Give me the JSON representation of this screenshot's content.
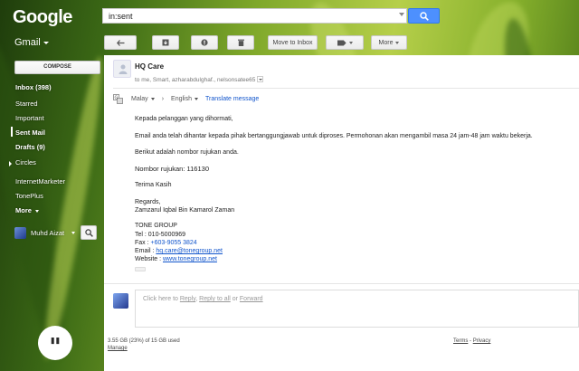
{
  "header": {
    "logo": "Google",
    "search_value": "in:sent"
  },
  "subheader": {
    "app_label": "Gmail",
    "move_to_inbox": "Move to Inbox",
    "more": "More"
  },
  "sidebar": {
    "compose": "COMPOSE",
    "items": [
      {
        "label": "Inbox (398)",
        "bold": true
      },
      {
        "label": "Starred",
        "bold": false
      },
      {
        "label": "Important",
        "bold": false
      },
      {
        "label": "Sent Mail",
        "bold": true
      },
      {
        "label": "Drafts (9)",
        "bold": true
      },
      {
        "label": "Circles",
        "bold": false
      },
      {
        "label": "InternetMarketer",
        "bold": false
      },
      {
        "label": "TonePlus",
        "bold": false
      },
      {
        "label": "More",
        "bold": true
      }
    ],
    "user_name": "Muhd Aizat"
  },
  "message": {
    "sender": "HQ Care",
    "recipients": "to me, Smart, azharabdulghaf., nelsonsatee65",
    "translate": {
      "from_lang": "Malay",
      "to_lang": "English",
      "link": "Translate message"
    },
    "body": {
      "greeting": "Kepada pelanggan yang dihormati,",
      "p1": "Email anda telah dihantar kepada pihak bertanggungjawab untuk diproses. Permohonan akan mengambil masa 24 jam-48 jam waktu bekerja.",
      "p2": "Berikut adalah nombor rujukan anda.",
      "ref": "Nombor rujukan: 116130",
      "thanks": "Terima Kasih",
      "regards": "Regards,",
      "signer": "Zamzarul Iqbal Bin Kamarol Zaman",
      "company": "TONE GROUP",
      "tel": "Tel  : 010-5000969",
      "fax_label": "Fax : ",
      "fax_value": "+603-9055 3824",
      "email_label": "Email  : ",
      "email_value": "hq.care@tonegroup.net",
      "website_label": "Website : ",
      "website_value": "www.tonegroup.net"
    },
    "reply": {
      "prefix": "Click here to ",
      "reply": "Reply",
      "sep1": ", ",
      "reply_all": "Reply to all",
      "sep2": " or ",
      "forward": "Forward"
    }
  },
  "footer": {
    "quota": "3.55 GB (23%) of 15 GB used",
    "manage": "Manage",
    "terms": "Terms",
    "dash": " - ",
    "privacy": "Privacy"
  },
  "colors": {
    "accent_blue": "#4d90fe",
    "link_blue": "#1155cc"
  }
}
